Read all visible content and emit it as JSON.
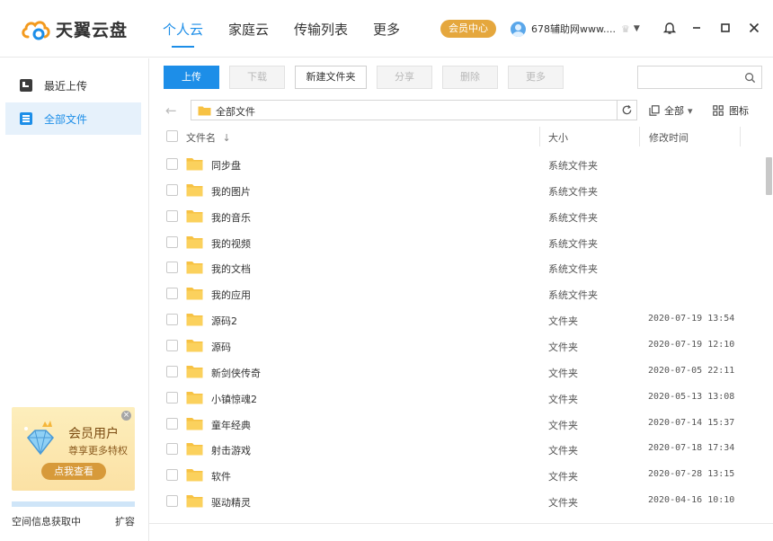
{
  "app": {
    "name": "天翼云盘"
  },
  "nav": {
    "tabs": [
      {
        "label": "个人云",
        "active": true
      },
      {
        "label": "家庭云"
      },
      {
        "label": "传输列表"
      },
      {
        "label": "更多"
      }
    ]
  },
  "header": {
    "vip_label": "会员中心",
    "username": "678辅助网www....",
    "crown": "♛",
    "caret": "▼"
  },
  "sidebar": {
    "items": [
      {
        "label": "最近上传",
        "icon": "recent-upload-icon"
      },
      {
        "label": "全部文件",
        "icon": "all-files-icon",
        "active": true
      }
    ],
    "promo": {
      "title": "会员用户",
      "subtitle": "尊享更多特权",
      "button": "点我查看",
      "close": "×"
    },
    "quota": {
      "text": "空间信息获取中",
      "expand_label": "扩容"
    }
  },
  "toolbar": {
    "upload": "上传",
    "download": "下载",
    "new_folder": "新建文件夹",
    "share": "分享",
    "delete": "删除",
    "more": "更多",
    "search_placeholder": ""
  },
  "address": {
    "back": "←",
    "path": "全部文件",
    "filter_label": "全部",
    "filter_caret": "▾",
    "view_label": "图标"
  },
  "table": {
    "headers": {
      "name": "文件名",
      "sort_arrow": "↓",
      "size": "大小",
      "modified": "修改时间"
    },
    "rows": [
      {
        "name": "同步盘",
        "size": "系统文件夹",
        "time": ""
      },
      {
        "name": "我的图片",
        "size": "系统文件夹",
        "time": ""
      },
      {
        "name": "我的音乐",
        "size": "系统文件夹",
        "time": ""
      },
      {
        "name": "我的视频",
        "size": "系统文件夹",
        "time": ""
      },
      {
        "name": "我的文档",
        "size": "系统文件夹",
        "time": ""
      },
      {
        "name": "我的应用",
        "size": "系统文件夹",
        "time": ""
      },
      {
        "name": "源码2",
        "size": "文件夹",
        "time": "2020-07-19 13:54"
      },
      {
        "name": "源码",
        "size": "文件夹",
        "time": "2020-07-19 12:10"
      },
      {
        "name": "新剑侠传奇",
        "size": "文件夹",
        "time": "2020-07-05 22:11"
      },
      {
        "name": "小镇惊魂2",
        "size": "文件夹",
        "time": "2020-05-13 13:08"
      },
      {
        "name": "童年经典",
        "size": "文件夹",
        "time": "2020-07-14 15:37"
      },
      {
        "name": "射击游戏",
        "size": "文件夹",
        "time": "2020-07-18 17:34"
      },
      {
        "name": "软件",
        "size": "文件夹",
        "time": "2020-07-28 13:15"
      },
      {
        "name": "驱动精灵",
        "size": "文件夹",
        "time": "2020-04-16 10:10"
      }
    ]
  },
  "colors": {
    "accent": "#1d8ee8",
    "folder": "#f7c244",
    "vip": "#e5a73d"
  }
}
